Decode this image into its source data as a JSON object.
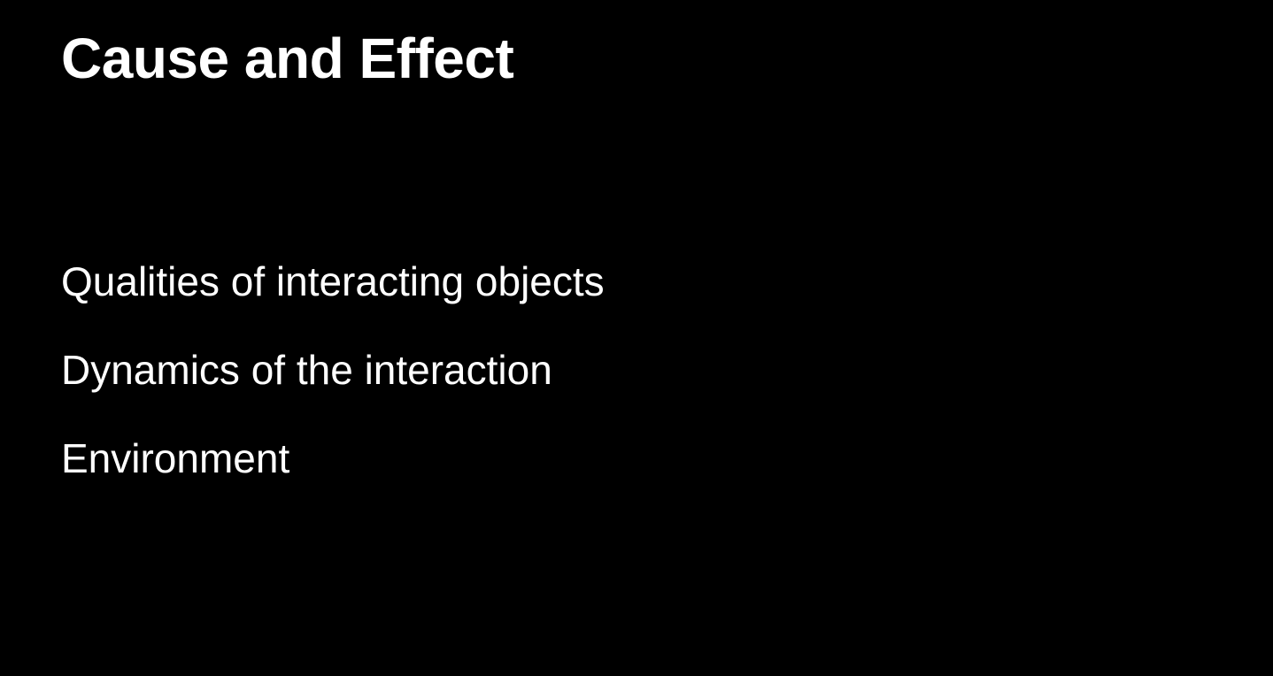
{
  "slide": {
    "title": "Cause and Effect",
    "bullets": [
      "Qualities of interacting objects",
      "Dynamics of the interaction",
      "Environment"
    ]
  },
  "colors": {
    "background": "#000000",
    "text": "#ffffff"
  }
}
